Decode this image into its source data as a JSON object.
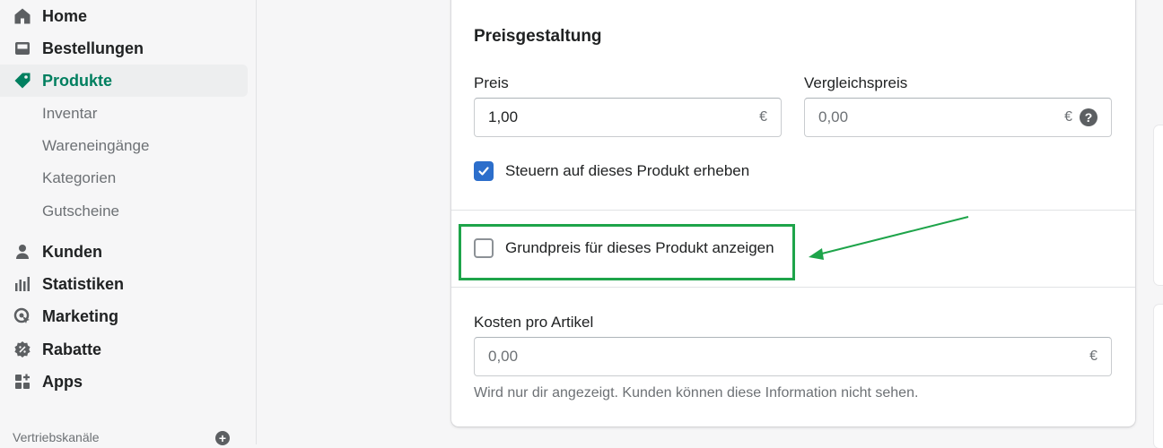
{
  "sidebar": {
    "items": [
      {
        "label": "Home",
        "icon": "home-icon"
      },
      {
        "label": "Bestellungen",
        "icon": "inbox-icon"
      },
      {
        "label": "Produkte",
        "icon": "tag-icon",
        "active": true
      }
    ],
    "sub_items": [
      "Inventar",
      "Wareneingänge",
      "Kategorien",
      "Gutscheine"
    ],
    "items2": [
      {
        "label": "Kunden",
        "icon": "person-icon"
      },
      {
        "label": "Statistiken",
        "icon": "bar-chart-icon"
      },
      {
        "label": "Marketing",
        "icon": "target-icon"
      },
      {
        "label": "Rabatte",
        "icon": "discount-icon"
      },
      {
        "label": "Apps",
        "icon": "apps-icon"
      }
    ],
    "sales_channels_label": "Vertriebskanäle",
    "add_channel_icon": "plus-circle-icon"
  },
  "pricing": {
    "title": "Preisgestaltung",
    "price_label": "Preis",
    "price_value": "1,00",
    "price_suffix": "€",
    "compare_label": "Vergleichspreis",
    "compare_placeholder": "0,00",
    "compare_suffix": "€",
    "help_icon": "question-circle-icon",
    "tax_checkbox_label": "Steuern auf dieses Produkt erheben",
    "tax_checked": true,
    "unit_price_checkbox_label": "Grundpreis für dieses Produkt anzeigen",
    "unit_price_checked": false,
    "cost_label": "Kosten pro Artikel",
    "cost_placeholder": "0,00",
    "cost_suffix": "€",
    "cost_help": "Wird nur dir angezeigt. Kunden können diese Information nicht sehen."
  },
  "colors": {
    "accent_active": "#007f5f",
    "checkbox_checked": "#2c6ecb",
    "annotation_green": "#1ea44a"
  }
}
